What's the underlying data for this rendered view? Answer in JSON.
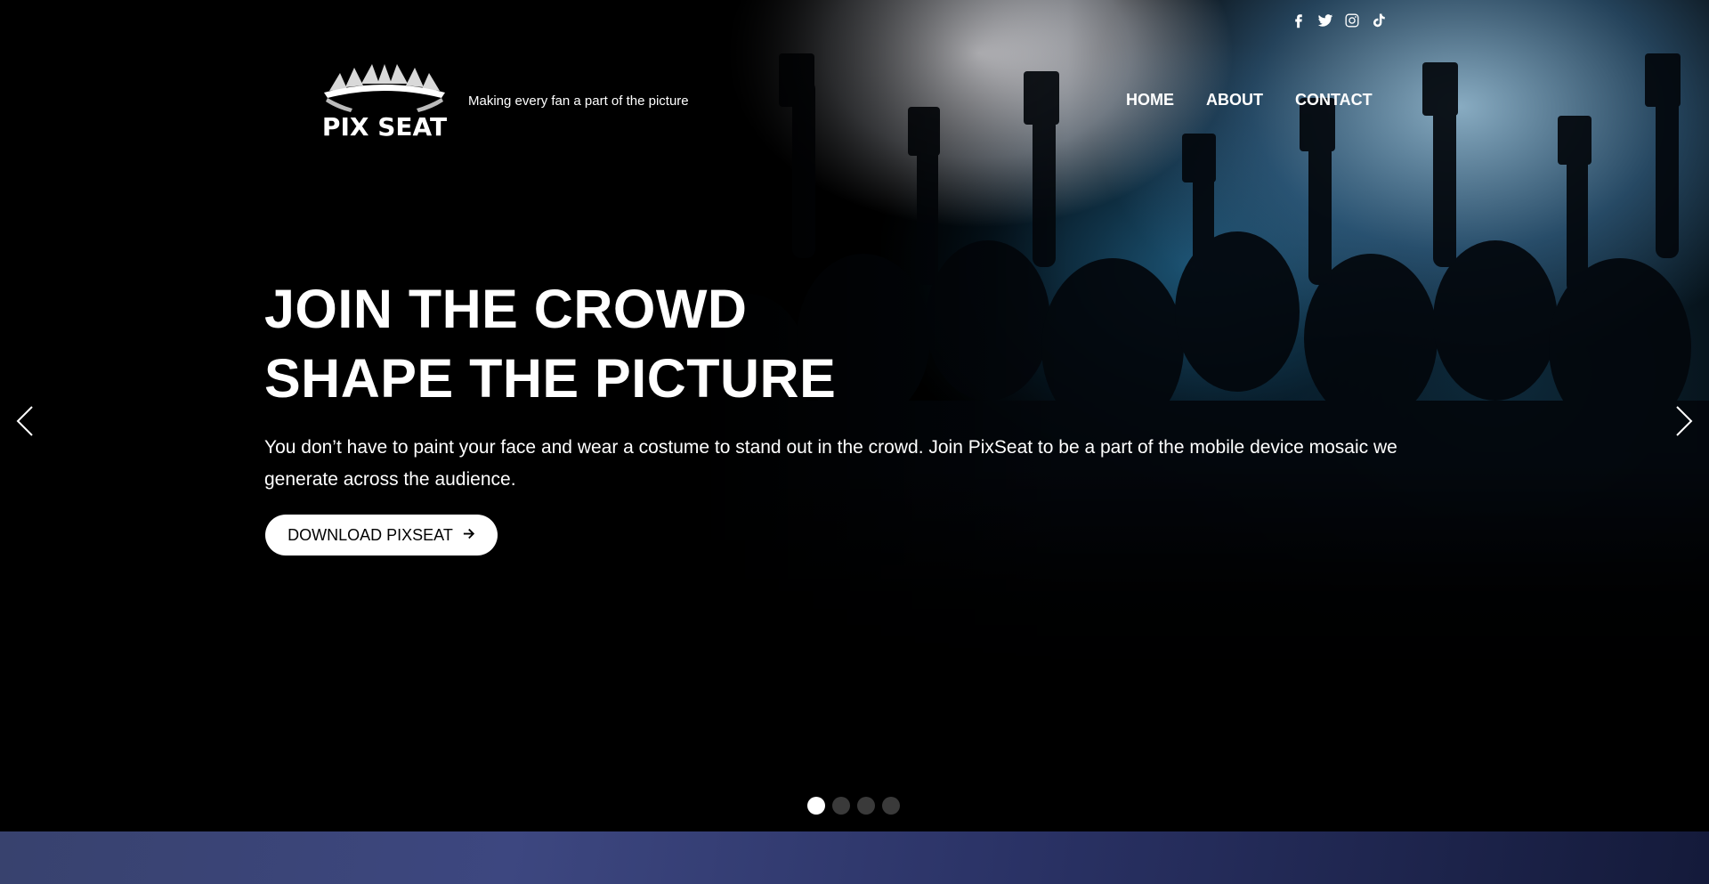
{
  "header": {
    "logo_text": "PIX SEAT",
    "tagline": "Making every fan a part of the picture",
    "social_icons": [
      "facebook-icon",
      "twitter-icon",
      "instagram-icon",
      "tiktok-icon"
    ],
    "nav": [
      {
        "label": "HOME"
      },
      {
        "label": "ABOUT"
      },
      {
        "label": "CONTACT"
      }
    ]
  },
  "hero": {
    "headline_line1": "JOIN THE CROWD",
    "headline_line2": "SHAPE THE PICTURE",
    "description": "You don’t have to paint your face and wear a costume to stand out in the crowd. Join PixSeat to be a part of the mobile device mosaic we generate across the audience.",
    "cta_label": "DOWNLOAD PIXSEAT",
    "cta_icon": "arrow-right-icon"
  },
  "carousel": {
    "prev_icon": "chevron-left-icon",
    "next_icon": "chevron-right-icon",
    "slide_count": 4,
    "active_slide": 1
  },
  "colors": {
    "background": "#000000",
    "text": "#ffffff",
    "cta_bg": "#ffffff",
    "dot_inactive": "#3a3a3a",
    "next_section": "#3d4780"
  }
}
